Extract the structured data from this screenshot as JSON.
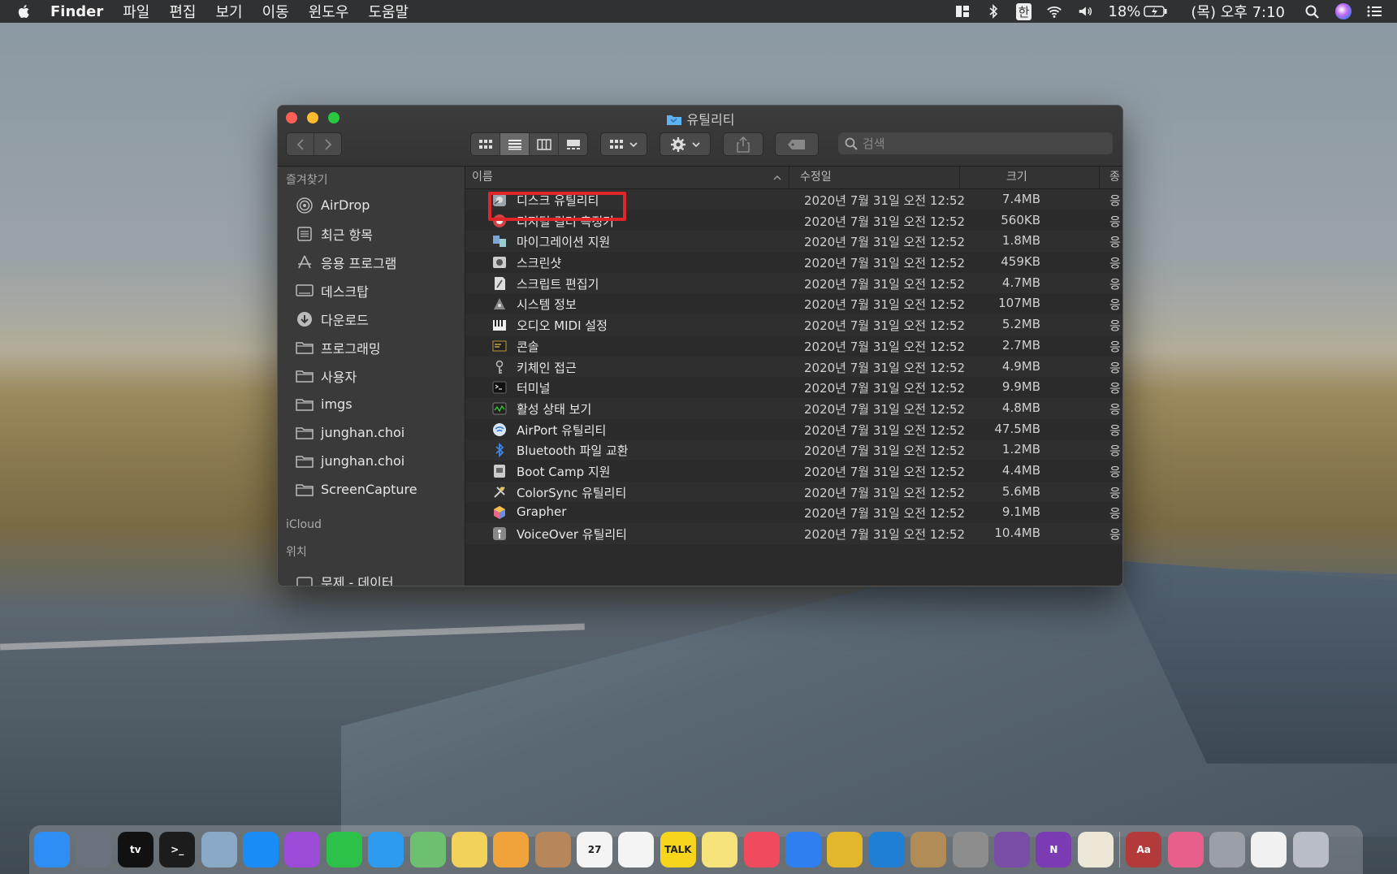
{
  "menubar": {
    "app_name": "Finder",
    "menus": [
      "파일",
      "편집",
      "보기",
      "이동",
      "윈도우",
      "도움말"
    ],
    "input_source": "한",
    "battery": "18%",
    "clock": "(목) 오후 7:10"
  },
  "window": {
    "title": "유틸리티",
    "search_placeholder": "검색"
  },
  "sidebar": {
    "favorites_header": "즐겨찾기",
    "favorites": [
      {
        "label": "AirDrop",
        "icon": "airdrop-icon"
      },
      {
        "label": "최근 항목",
        "icon": "recents-icon"
      },
      {
        "label": "응용 프로그램",
        "icon": "applications-icon"
      },
      {
        "label": "데스크탑",
        "icon": "desktop-icon"
      },
      {
        "label": "다운로드",
        "icon": "downloads-icon"
      },
      {
        "label": "프로그래밍",
        "icon": "folder-icon"
      },
      {
        "label": "사용자",
        "icon": "folder-icon"
      },
      {
        "label": "imgs",
        "icon": "folder-icon"
      },
      {
        "label": "junghan.choi",
        "icon": "folder-icon"
      },
      {
        "label": "junghan.choi",
        "icon": "folder-icon"
      },
      {
        "label": "ScreenCapture",
        "icon": "folder-icon"
      }
    ],
    "icloud_header": "iCloud",
    "locations_header": "위치",
    "locations": [
      {
        "label": "무제 - 데이터",
        "icon": "disk-icon"
      }
    ]
  },
  "list": {
    "columns": {
      "name": "이름",
      "date": "수정일",
      "size": "크기",
      "kind": "종"
    },
    "rows": [
      {
        "name": "디스크 유틸리티",
        "date": "2020년 7월 31일 오전 12:52",
        "size": "7.4MB",
        "kind": "응"
      },
      {
        "name": "디지털 컬러 측정기",
        "date": "2020년 7월 31일 오전 12:52",
        "size": "560KB",
        "kind": "응"
      },
      {
        "name": "마이그레이션 지원",
        "date": "2020년 7월 31일 오전 12:52",
        "size": "1.8MB",
        "kind": "응"
      },
      {
        "name": "스크린샷",
        "date": "2020년 7월 31일 오전 12:52",
        "size": "459KB",
        "kind": "응"
      },
      {
        "name": "스크립트 편집기",
        "date": "2020년 7월 31일 오전 12:52",
        "size": "4.7MB",
        "kind": "응"
      },
      {
        "name": "시스템 정보",
        "date": "2020년 7월 31일 오전 12:52",
        "size": "107MB",
        "kind": "응"
      },
      {
        "name": "오디오 MIDI 설정",
        "date": "2020년 7월 31일 오전 12:52",
        "size": "5.2MB",
        "kind": "응"
      },
      {
        "name": "콘솔",
        "date": "2020년 7월 31일 오전 12:52",
        "size": "2.7MB",
        "kind": "응"
      },
      {
        "name": "키체인 접근",
        "date": "2020년 7월 31일 오전 12:52",
        "size": "4.9MB",
        "kind": "응"
      },
      {
        "name": "터미널",
        "date": "2020년 7월 31일 오전 12:52",
        "size": "9.9MB",
        "kind": "응"
      },
      {
        "name": "활성 상태 보기",
        "date": "2020년 7월 31일 오전 12:52",
        "size": "4.8MB",
        "kind": "응"
      },
      {
        "name": "AirPort 유틸리티",
        "date": "2020년 7월 31일 오전 12:52",
        "size": "47.5MB",
        "kind": "응"
      },
      {
        "name": "Bluetooth 파일 교환",
        "date": "2020년 7월 31일 오전 12:52",
        "size": "1.2MB",
        "kind": "응"
      },
      {
        "name": "Boot Camp 지원",
        "date": "2020년 7월 31일 오전 12:52",
        "size": "4.4MB",
        "kind": "응"
      },
      {
        "name": "ColorSync 유틸리티",
        "date": "2020년 7월 31일 오전 12:52",
        "size": "5.6MB",
        "kind": "응"
      },
      {
        "name": "Grapher",
        "date": "2020년 7월 31일 오전 12:52",
        "size": "9.1MB",
        "kind": "응"
      },
      {
        "name": "VoiceOver 유틸리티",
        "date": "2020년 7월 31일 오전 12:52",
        "size": "10.4MB",
        "kind": "응"
      }
    ]
  },
  "dock": {
    "apps": [
      {
        "name": "finder",
        "color": "#2f8ef4"
      },
      {
        "name": "launchpad",
        "color": "#6b7280"
      },
      {
        "name": "apple-tv",
        "color": "#111111",
        "label": "tv"
      },
      {
        "name": "terminal",
        "color": "#1c1c1c",
        "label": ">_"
      },
      {
        "name": "preview",
        "color": "#8aa9c6"
      },
      {
        "name": "app-store",
        "color": "#1a8cf5"
      },
      {
        "name": "podcasts",
        "color": "#9c4bd9"
      },
      {
        "name": "facetime",
        "color": "#2cc24a"
      },
      {
        "name": "messages",
        "color": "#2d9bf0"
      },
      {
        "name": "maps",
        "color": "#6cc070"
      },
      {
        "name": "stickies",
        "color": "#f2d25b"
      },
      {
        "name": "photos",
        "color": "#f0a23b"
      },
      {
        "name": "contacts",
        "color": "#b8865b"
      },
      {
        "name": "calendar",
        "color": "#f4f4f4",
        "label": "27"
      },
      {
        "name": "reminders",
        "color": "#f4f4f4"
      },
      {
        "name": "kakaotalk",
        "color": "#f7d51d",
        "label": "TALK"
      },
      {
        "name": "notes",
        "color": "#f6e27a"
      },
      {
        "name": "music",
        "color": "#f04a5e"
      },
      {
        "name": "safari",
        "color": "#2f7ff0"
      },
      {
        "name": "chrome",
        "color": "#e3b72b"
      },
      {
        "name": "vscode",
        "color": "#1f7fd4"
      },
      {
        "name": "archive-utility",
        "color": "#b08d57"
      },
      {
        "name": "system-preferences",
        "color": "#8d8d8d"
      },
      {
        "name": "github-desktop",
        "color": "#7a4ea6"
      },
      {
        "name": "onenote",
        "color": "#7b3bb3",
        "label": "N"
      },
      {
        "name": "textedit",
        "color": "#ece6d6"
      }
    ],
    "extras": [
      {
        "name": "dictionary",
        "color": "#b23a3a",
        "label": "Aa"
      },
      {
        "name": "downloads-stack",
        "color": "#e85f8c"
      },
      {
        "name": "disk-utility-stack",
        "color": "#9aa0a6"
      },
      {
        "name": "documents-stack",
        "color": "#f1f1f1"
      },
      {
        "name": "trash",
        "color": "#b9bec4"
      }
    ]
  }
}
